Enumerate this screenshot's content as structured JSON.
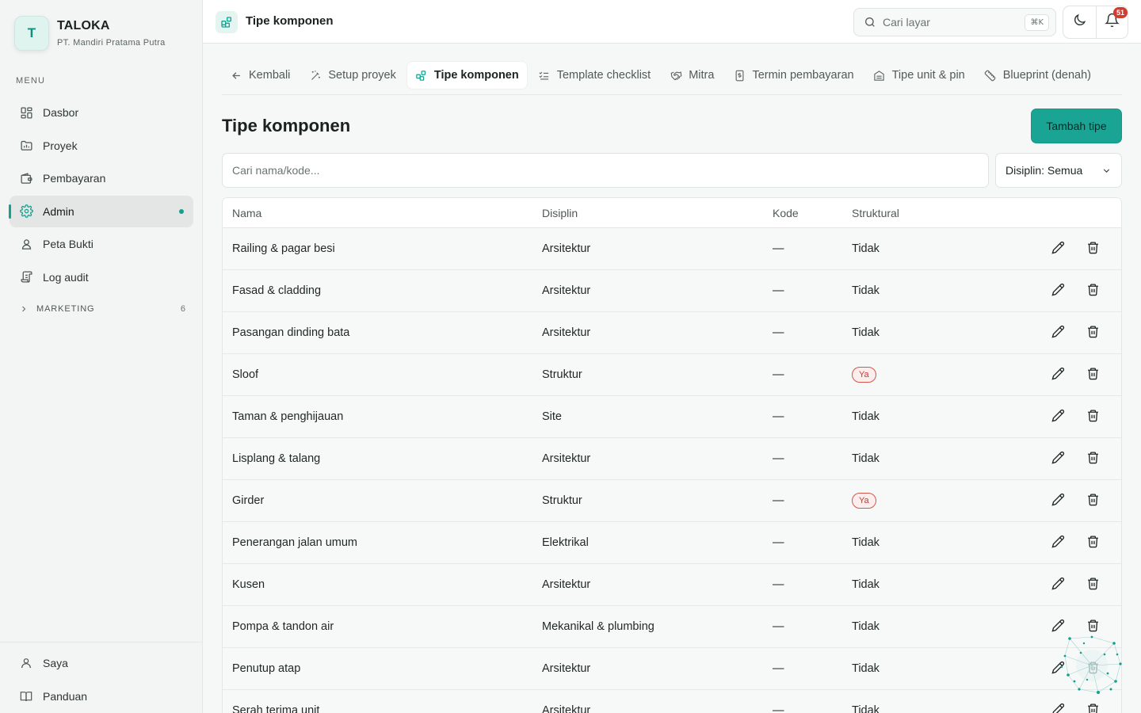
{
  "brand": {
    "initial": "T",
    "name": "TALOKA",
    "company": "PT. Mandiri Pratama Putra"
  },
  "sidebar": {
    "menu_label": "MENU",
    "items": [
      {
        "label": "Dasbor",
        "icon": "dashboard-icon"
      },
      {
        "label": "Proyek",
        "icon": "folder-icon"
      },
      {
        "label": "Pembayaran",
        "icon": "wallet-icon"
      },
      {
        "label": "Admin",
        "icon": "gear-icon",
        "active": true
      },
      {
        "label": "Peta Bukti",
        "icon": "user-pin-icon"
      },
      {
        "label": "Log audit",
        "icon": "scroll-icon"
      }
    ],
    "group": {
      "label": "MARKETING",
      "count": "6"
    },
    "bottom": [
      {
        "label": "Saya",
        "icon": "user-icon"
      },
      {
        "label": "Panduan",
        "icon": "book-icon"
      }
    ]
  },
  "topbar": {
    "title": "Tipe komponen",
    "search_placeholder": "Cari layar",
    "shortcut": "⌘K",
    "notification_count": "51"
  },
  "tabs": [
    {
      "label": "Kembali",
      "icon": "arrow-left-icon"
    },
    {
      "label": "Setup proyek",
      "icon": "wand-icon"
    },
    {
      "label": "Tipe komponen",
      "icon": "blocks-icon",
      "active": true
    },
    {
      "label": "Template checklist",
      "icon": "checklist-icon"
    },
    {
      "label": "Mitra",
      "icon": "handshake-icon"
    },
    {
      "label": "Termin pembayaran",
      "icon": "receipt-icon"
    },
    {
      "label": "Tipe unit & pin",
      "icon": "building-icon"
    },
    {
      "label": "Blueprint (denah)",
      "icon": "ruler-icon"
    }
  ],
  "page": {
    "title": "Tipe komponen",
    "add_button": "Tambah tipe",
    "filter_placeholder": "Cari nama/kode...",
    "discipline_select": "Disiplin: Semua"
  },
  "table": {
    "columns": [
      "Nama",
      "Disiplin",
      "Kode",
      "Struktural"
    ],
    "rows": [
      {
        "name": "Railing & pagar besi",
        "discipline": "Arsitektur",
        "code": "—",
        "structural": "Tidak"
      },
      {
        "name": "Fasad & cladding",
        "discipline": "Arsitektur",
        "code": "—",
        "structural": "Tidak"
      },
      {
        "name": "Pasangan dinding bata",
        "discipline": "Arsitektur",
        "code": "—",
        "structural": "Tidak"
      },
      {
        "name": "Sloof",
        "discipline": "Struktur",
        "code": "—",
        "structural": "Ya"
      },
      {
        "name": "Taman & penghijauan",
        "discipline": "Site",
        "code": "—",
        "structural": "Tidak"
      },
      {
        "name": "Lisplang & talang",
        "discipline": "Arsitektur",
        "code": "—",
        "structural": "Tidak"
      },
      {
        "name": "Girder",
        "discipline": "Struktur",
        "code": "—",
        "structural": "Ya"
      },
      {
        "name": "Penerangan jalan umum",
        "discipline": "Elektrikal",
        "code": "—",
        "structural": "Tidak"
      },
      {
        "name": "Kusen",
        "discipline": "Arsitektur",
        "code": "—",
        "structural": "Tidak"
      },
      {
        "name": "Pompa & tandon air",
        "discipline": "Mekanikal & plumbing",
        "code": "—",
        "structural": "Tidak"
      },
      {
        "name": "Penutup atap",
        "discipline": "Arsitektur",
        "code": "—",
        "structural": "Tidak"
      },
      {
        "name": "Serah terima unit",
        "discipline": "Arsitektur",
        "code": "—",
        "structural": "Tidak"
      }
    ]
  },
  "colors": {
    "accent": "#1aa494",
    "danger": "#d13b30",
    "badge_ya": "#c23a2f"
  }
}
